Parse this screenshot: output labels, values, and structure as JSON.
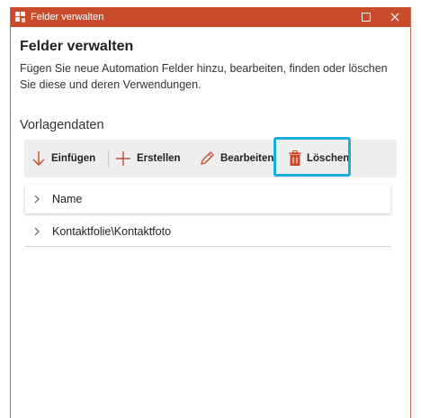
{
  "window": {
    "title": "Felder verwalten",
    "accent_color": "#c84c2c",
    "highlight_color": "#19b1d9"
  },
  "main": {
    "heading": "Felder verwalten",
    "description": "Fügen Sie neue Automation Felder hinzu, bearbeiten, finden oder löschen Sie diese und deren Verwendungen.",
    "section_label": "Vorlagendaten"
  },
  "toolbar": {
    "insert_label": "Einfügen",
    "create_label": "Erstellen",
    "edit_label": "Bearbeiten",
    "delete_label": "Löschen",
    "icons": [
      "arrow-down-icon",
      "plus-icon",
      "pencil-icon",
      "trash-icon"
    ]
  },
  "fields": [
    {
      "label": "Name",
      "selected": true
    },
    {
      "label": "Kontaktfolie\\Kontaktfoto",
      "selected": false
    }
  ]
}
